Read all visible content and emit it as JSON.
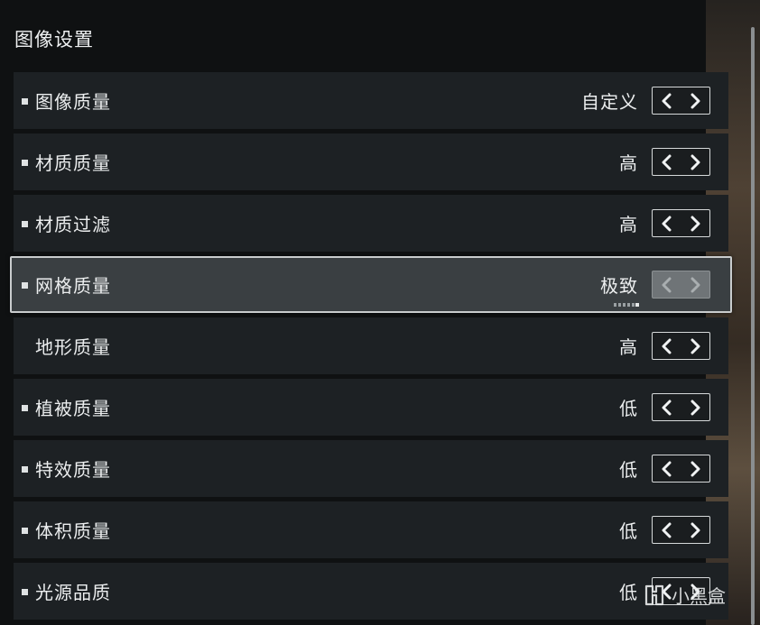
{
  "page": {
    "title": "图像设置"
  },
  "settings": [
    {
      "label": "图像质量",
      "value": "自定义",
      "bullet": true,
      "selected": false
    },
    {
      "label": "材质质量",
      "value": "高",
      "bullet": true,
      "selected": false
    },
    {
      "label": "材质过滤",
      "value": "高",
      "bullet": true,
      "selected": false
    },
    {
      "label": "网格质量",
      "value": "极致",
      "bullet": true,
      "selected": true
    },
    {
      "label": "地形质量",
      "value": "高",
      "bullet": false,
      "selected": false
    },
    {
      "label": "植被质量",
      "value": "低",
      "bullet": true,
      "selected": false
    },
    {
      "label": "特效质量",
      "value": "低",
      "bullet": true,
      "selected": false
    },
    {
      "label": "体积质量",
      "value": "低",
      "bullet": true,
      "selected": false
    },
    {
      "label": "光源品质",
      "value": "低",
      "bullet": true,
      "selected": false
    }
  ],
  "icons": {
    "prev": "chevron-left-icon",
    "next": "chevron-right-icon",
    "bullet": "square-bullet-icon"
  },
  "watermark": {
    "text": "小黑盒"
  },
  "colors": {
    "row_bg": "#1d2124",
    "selected_bg": "#3a3f42",
    "selected_border": "#c9cccd",
    "text": "#eceeef"
  }
}
